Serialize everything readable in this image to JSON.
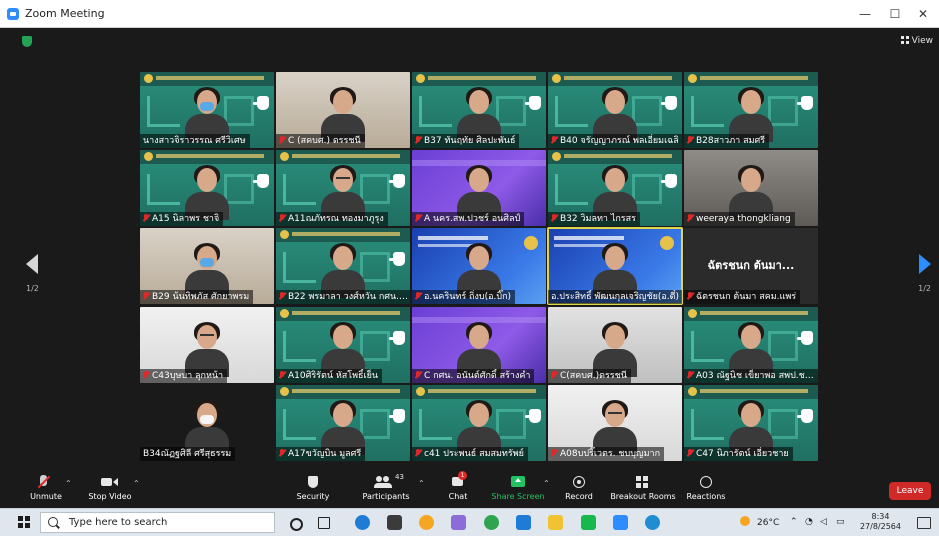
{
  "window": {
    "title": "Zoom Meeting",
    "controls": {
      "minimize": "—",
      "maximize": "☐",
      "close": "✕"
    }
  },
  "stage": {
    "view_label": "View",
    "page_indicator_left": "1/2",
    "page_indicator_right": "1/2"
  },
  "participants": [
    {
      "name": "นางสาวจิราวรรณ ศรีวิเศษ",
      "muted": false,
      "bg": "green",
      "mask": "blue"
    },
    {
      "name": "C (สคบศ.) ดรรชนี",
      "muted": true,
      "bg": "room"
    },
    {
      "name": "B37 ทันฤทัย ศิลปะพันธ์",
      "muted": true,
      "bg": "green"
    },
    {
      "name": "B40 จรัญญาภรณ์ พลเอี่ยมเฉลิ",
      "muted": true,
      "bg": "green"
    },
    {
      "name": "B28สาวภา สมศรี",
      "muted": true,
      "bg": "green"
    },
    {
      "name": "A15 นิลาพร ชาจิ",
      "muted": true,
      "bg": "green"
    },
    {
      "name": "A11ณภัทรณ ทองมาภูรุง",
      "muted": true,
      "bg": "green",
      "glasses": true
    },
    {
      "name": "A นคร.สพ.ปวชร์ อนศิลป์",
      "muted": true,
      "bg": "purple"
    },
    {
      "name": "B32 วิมลทา ไกรสร",
      "muted": true,
      "bg": "green"
    },
    {
      "name": "weeraya thongkliang",
      "muted": true,
      "bg": "office"
    },
    {
      "name": "B29 น้นทิพภัส ศักยาพรม",
      "muted": true,
      "bg": "room",
      "mask": "blue"
    },
    {
      "name": "B22 พรมาลา วงศ์หวัน กศน.ชร.",
      "muted": true,
      "bg": "green"
    },
    {
      "name": "อ.นครินทร์ ถิ่งบ(อ.บิ๊ก)",
      "muted": true,
      "bg": "blue"
    },
    {
      "name": "อ.ประสิทธิ์ พัฒนกุลเจริญชัย(อ.ตี๋)",
      "muted": false,
      "bg": "blue",
      "active": true
    },
    {
      "name": "ฉัตรชนก ต้นมา สคม.แพร่",
      "muted": true,
      "bg": "dark",
      "avatar_text": "ฉัตรชนก ต้นมา..."
    },
    {
      "name": "C43บุษบา ลุกหน้า",
      "muted": true,
      "bg": "white",
      "glasses": true
    },
    {
      "name": "A10ศิริรัตน์ หัสโพธิ์เย็น",
      "muted": true,
      "bg": "green"
    },
    {
      "name": "C กศน. อนันต์ศักดิ์ สร้างคำ",
      "muted": true,
      "bg": "purple"
    },
    {
      "name": "C(สคบศ.)ดรรชนี",
      "muted": true,
      "bg": "gray"
    },
    {
      "name": "A03 ณัฐนิช เข็ยาพอ สพป.ชบ.3",
      "muted": true,
      "bg": "green"
    },
    {
      "name": "B34ณัฏฐศิลี ศรีสุธรรม",
      "muted": false,
      "bg": "black",
      "mask": "white"
    },
    {
      "name": "A17ขวัญบิน มูลศรี",
      "muted": true,
      "bg": "green"
    },
    {
      "name": "c41 ประพนธ์ สมสมทรัพย์",
      "muted": true,
      "bg": "green"
    },
    {
      "name": "A08บปริ๊เวตร. ชบบุญมาก",
      "muted": true,
      "bg": "white",
      "glasses": true
    },
    {
      "name": "C47 นิภารัตน์ เอี่ยวชาย",
      "muted": true,
      "bg": "green"
    }
  ],
  "toolbar": {
    "unmute": "Unmute",
    "stop_video": "Stop Video",
    "security": "Security",
    "participants": "Participants",
    "participants_count": "43",
    "chat": "Chat",
    "chat_badge": "1",
    "share_screen": "Share Screen",
    "record": "Record",
    "breakout_rooms": "Breakout Rooms",
    "reactions": "Reactions",
    "leave": "Leave"
  },
  "taskbar": {
    "search_placeholder": "Type here to search",
    "weather": "26°C",
    "time": "8:34",
    "date": "27/8/2564"
  },
  "colors": {
    "zoom_blue": "#2D8CFF",
    "leave_red": "#CF2A27",
    "share_green": "#24C164",
    "active_speaker": "#E0D64A"
  }
}
